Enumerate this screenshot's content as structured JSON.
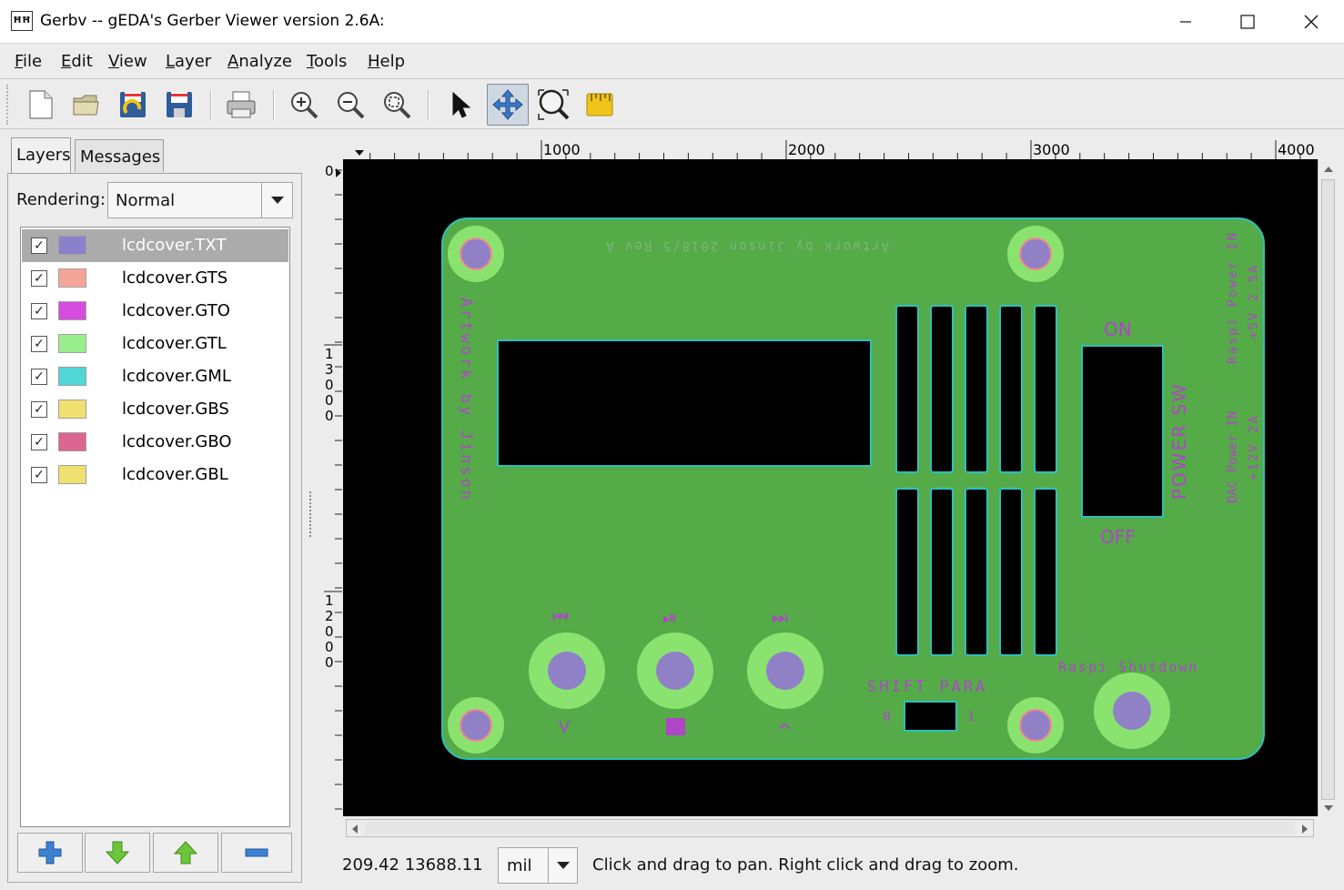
{
  "window": {
    "icon_text": "ĦĦ",
    "title": "Gerbv -- gEDA's Gerber Viewer version 2.6A:",
    "controls": [
      "minimize-icon",
      "maximize-icon",
      "close-icon"
    ]
  },
  "menu": [
    "File",
    "Edit",
    "View",
    "Layer",
    "Analyze",
    "Tools",
    "Help"
  ],
  "toolbar": {
    "buttons": [
      "new-document-icon",
      "open-folder-icon",
      "revert-icon",
      "save-icon",
      "print-icon",
      "zoom-in-icon",
      "zoom-out-icon",
      "zoom-fit-icon",
      "pointer-tool-icon",
      "pan-tool-icon",
      "zoom-tool-icon",
      "measure-tool-icon"
    ],
    "active": "pan-tool-icon"
  },
  "tabs": [
    {
      "label": "Layers",
      "selected": true
    },
    {
      "label": "Messages",
      "selected": false
    }
  ],
  "rendering": {
    "label": "Rendering:",
    "value": "Normal"
  },
  "layers": [
    {
      "name": "lcdcover.TXT",
      "color": "#8b80cc",
      "checked": true,
      "selected": true
    },
    {
      "name": "lcdcover.GTS",
      "color": "#f4a59a",
      "checked": true,
      "selected": false
    },
    {
      "name": "lcdcover.GTO",
      "color": "#d54cde",
      "checked": true,
      "selected": false
    },
    {
      "name": "lcdcover.GTL",
      "color": "#98ed8c",
      "checked": true,
      "selected": false
    },
    {
      "name": "lcdcover.GML",
      "color": "#4fd6d6",
      "checked": true,
      "selected": false
    },
    {
      "name": "lcdcover.GBS",
      "color": "#f0e070",
      "checked": true,
      "selected": false
    },
    {
      "name": "lcdcover.GBO",
      "color": "#dd6690",
      "checked": true,
      "selected": false
    },
    {
      "name": "lcdcover.GBL",
      "color": "#f0e070",
      "checked": true,
      "selected": false
    }
  ],
  "layer_buttons": [
    "add-layer-icon",
    "move-down-icon",
    "move-up-icon",
    "remove-layer-icon"
  ],
  "rulers": {
    "horizontal": [
      "1000",
      "2000",
      "3000",
      "4000"
    ],
    "vertical_zero": "0",
    "vertical": [
      "13000",
      "12000"
    ]
  },
  "board": {
    "top_text": "Artwork by Jinson 2018/5 Rev A",
    "side_text": "Artwork by Jinson",
    "raspi_power_1": "Raspi Power IN",
    "raspi_power_2": "+5V 2.5A",
    "dac_power_1": "DAC Power IN",
    "dac_power_2": "+12V 2A",
    "switch_on": "ON",
    "switch_off": "OFF",
    "switch_label": "POWER SW",
    "btn_prev": "⏮",
    "btn_play": "⏯",
    "btn_next": "⏭",
    "btn_down": "V",
    "btn_up": "^",
    "shift_label": "SHIFT PARA",
    "shift_0": "0",
    "shift_1": "1",
    "shutdown_label": "Raspi Shutdown"
  },
  "status": {
    "coords": "209.42 13688.11",
    "unit": "mil",
    "message": "Click and drag to pan. Right click and drag to zoom."
  },
  "colors": {
    "board_fill": "#54ab48",
    "outline": "#2ec0c0",
    "silk": "#b045c8",
    "pad_ring": "#8ae36f",
    "pad_center": "#9081c6",
    "mask_edge": "#f08a8a"
  }
}
